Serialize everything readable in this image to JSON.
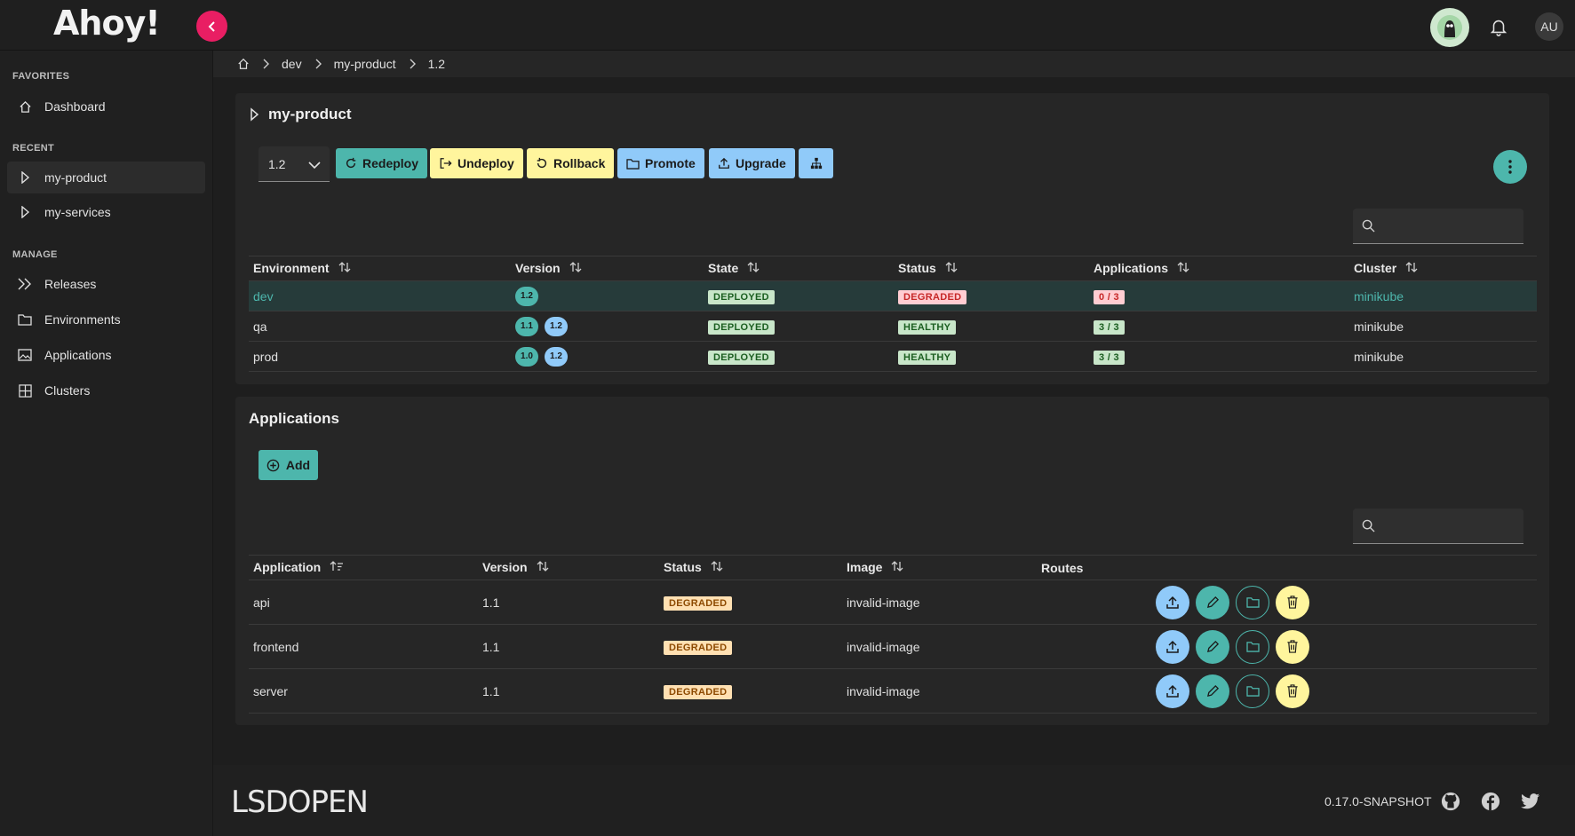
{
  "app": {
    "logo_text": "Ahoy!",
    "user_initials": "AU"
  },
  "icons": {
    "back": "chevron-left-icon",
    "notifications": "bell-icon",
    "home": "home-icon",
    "search": "search-icon",
    "more": "more-vert-icon"
  },
  "colors": {
    "accent": "#4db6ac",
    "warning": "#fff59d",
    "info": "#90caf9",
    "danger": "#e91e63"
  },
  "sidebar": {
    "favorites_heading": "FAVORITES",
    "favorites": [
      {
        "label": "Dashboard",
        "icon": "home-icon"
      }
    ],
    "recent_heading": "RECENT",
    "recent": [
      {
        "label": "my-product",
        "icon": "caret-right-icon"
      },
      {
        "label": "my-services",
        "icon": "caret-right-icon"
      }
    ],
    "manage_heading": "MANAGE",
    "manage": [
      {
        "label": "Releases",
        "icon": "double-chevron-icon"
      },
      {
        "label": "Environments",
        "icon": "folder-icon"
      },
      {
        "label": "Applications",
        "icon": "image-icon"
      },
      {
        "label": "Clusters",
        "icon": "grid-icon"
      }
    ]
  },
  "breadcrumb": {
    "items": [
      "dev",
      "my-product",
      "1.2"
    ]
  },
  "release": {
    "title": "my-product",
    "version_selected": "1.2",
    "actions": {
      "redeploy": "Redeploy",
      "undeploy": "Undeploy",
      "rollback": "Rollback",
      "promote": "Promote",
      "upgrade": "Upgrade"
    },
    "search_placeholder": "",
    "columns": [
      "Environment",
      "Version",
      "State",
      "Status",
      "Applications",
      "Cluster"
    ],
    "rows": [
      {
        "environment": "dev",
        "versions": [
          "1.2"
        ],
        "state": "DEPLOYED",
        "status": "DEGRADED",
        "applications": "0 / 3",
        "cluster": "minikube"
      },
      {
        "environment": "qa",
        "versions": [
          "1.1",
          "1.2"
        ],
        "state": "DEPLOYED",
        "status": "HEALTHY",
        "applications": "3 / 3",
        "cluster": "minikube"
      },
      {
        "environment": "prod",
        "versions": [
          "1.0",
          "1.2"
        ],
        "state": "DEPLOYED",
        "status": "HEALTHY",
        "applications": "3 / 3",
        "cluster": "minikube"
      }
    ]
  },
  "applications": {
    "title": "Applications",
    "add_label": "Add",
    "search_placeholder": "",
    "columns": [
      "Application",
      "Version",
      "Status",
      "Image",
      "Routes"
    ],
    "rows": [
      {
        "application": "api",
        "version": "1.1",
        "status": "DEGRADED",
        "image": "invalid-image",
        "routes": ""
      },
      {
        "application": "frontend",
        "version": "1.1",
        "status": "DEGRADED",
        "image": "invalid-image",
        "routes": ""
      },
      {
        "application": "server",
        "version": "1.1",
        "status": "DEGRADED",
        "image": "invalid-image",
        "routes": ""
      }
    ]
  },
  "footer": {
    "brand": "LSDOPEN",
    "version": "0.17.0-SNAPSHOT",
    "social": [
      "github-icon",
      "facebook-icon",
      "twitter-icon"
    ]
  }
}
